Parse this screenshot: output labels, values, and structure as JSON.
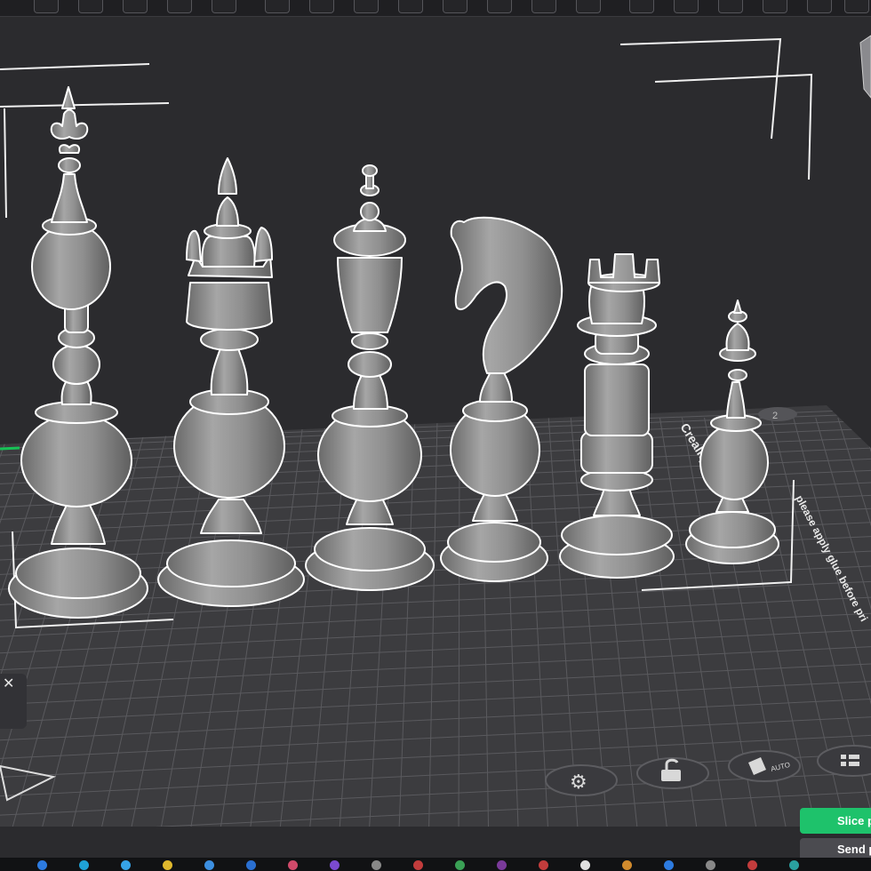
{
  "toolbar": {
    "button_count": 22,
    "icons": [
      "move-icon",
      "rotate-icon",
      "scale-icon",
      "cut-icon",
      "support-icon",
      "seam-icon",
      "paint-icon",
      "text-icon",
      "measure-icon",
      "assembly-icon",
      "arrange-icon",
      "orient-icon",
      "layers-icon",
      "split-objects-icon",
      "split-parts-icon",
      "variable-height-icon",
      "add-plate-icon",
      "lock-icon",
      "grid-icon",
      "list-icon",
      "view-icon",
      "search-icon"
    ]
  },
  "viewport": {
    "plate_texts": [
      "Creality",
      "please apply glue before pri"
    ],
    "plate_number": "2",
    "objects": [
      {
        "name": "king",
        "selected": true
      },
      {
        "name": "queen",
        "selected": true
      },
      {
        "name": "bishop",
        "selected": true
      },
      {
        "name": "knight",
        "selected": true
      },
      {
        "name": "rook",
        "selected": true
      },
      {
        "name": "pawn",
        "selected": true
      }
    ],
    "plate_tools": [
      {
        "icon": "gear-icon"
      },
      {
        "icon": "lock-icon"
      },
      {
        "icon": "auto-orient-icon",
        "label": "AUTO"
      },
      {
        "icon": "grid-layout-icon"
      }
    ],
    "side_panel": {
      "close_label": "✕"
    }
  },
  "actions": {
    "slice_label": "Slice plate",
    "send_label": "Send print"
  },
  "colors": {
    "background": "#2b2b2e",
    "plate_surface": "#3d3d40",
    "grid_line": "#5c5c60",
    "model": "#8f8f8f",
    "selection_outline": "#ffffff",
    "accent_green": "#1ec26b"
  },
  "taskbar": {
    "icons": [
      "edge-icon",
      "chrome-icon",
      "store-icon",
      "files-icon",
      "photos-icon",
      "mail-icon",
      "notif-icon",
      "vs-icon",
      "app-icon",
      "app-icon",
      "app-icon",
      "app-icon",
      "app-icon",
      "app-icon",
      "app-icon",
      "app-icon",
      "app-icon",
      "app-icon",
      "app-icon"
    ]
  }
}
